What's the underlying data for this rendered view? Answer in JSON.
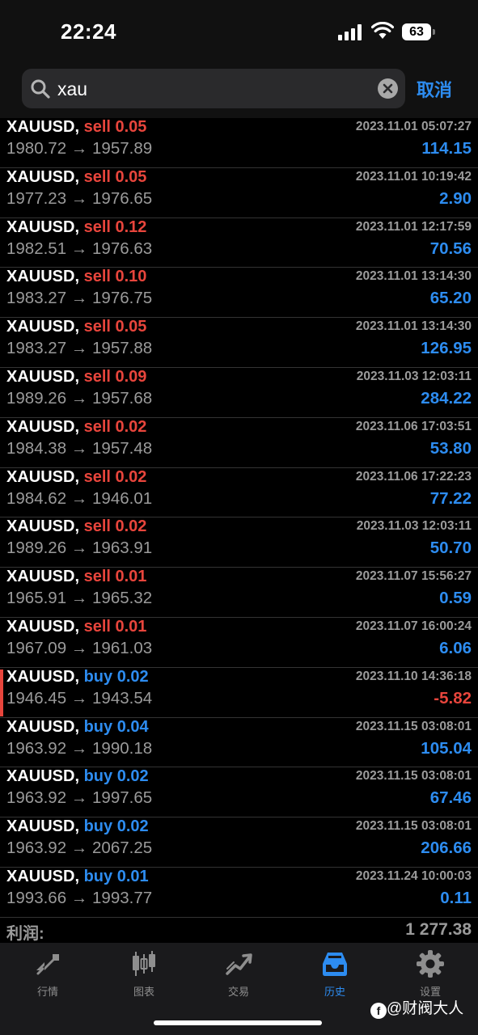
{
  "status_bar": {
    "time": "22:24",
    "battery": "63"
  },
  "search": {
    "value": "xau",
    "cancel_label": "取消"
  },
  "trades": [
    {
      "symbol": "XAUUSD,",
      "side": "sell",
      "volume": "0.05",
      "date": "2023.11.01 05:07:27",
      "open": "1980.72",
      "close": "1957.89",
      "profit": "114.15"
    },
    {
      "symbol": "XAUUSD,",
      "side": "sell",
      "volume": "0.05",
      "date": "2023.11.01 10:19:42",
      "open": "1977.23",
      "close": "1976.65",
      "profit": "2.90"
    },
    {
      "symbol": "XAUUSD,",
      "side": "sell",
      "volume": "0.12",
      "date": "2023.11.01 12:17:59",
      "open": "1982.51",
      "close": "1976.63",
      "profit": "70.56"
    },
    {
      "symbol": "XAUUSD,",
      "side": "sell",
      "volume": "0.10",
      "date": "2023.11.01 13:14:30",
      "open": "1983.27",
      "close": "1976.75",
      "profit": "65.20"
    },
    {
      "symbol": "XAUUSD,",
      "side": "sell",
      "volume": "0.05",
      "date": "2023.11.01 13:14:30",
      "open": "1983.27",
      "close": "1957.88",
      "profit": "126.95"
    },
    {
      "symbol": "XAUUSD,",
      "side": "sell",
      "volume": "0.09",
      "date": "2023.11.03 12:03:11",
      "open": "1989.26",
      "close": "1957.68",
      "profit": "284.22"
    },
    {
      "symbol": "XAUUSD,",
      "side": "sell",
      "volume": "0.02",
      "date": "2023.11.06 17:03:51",
      "open": "1984.38",
      "close": "1957.48",
      "profit": "53.80"
    },
    {
      "symbol": "XAUUSD,",
      "side": "sell",
      "volume": "0.02",
      "date": "2023.11.06 17:22:23",
      "open": "1984.62",
      "close": "1946.01",
      "profit": "77.22"
    },
    {
      "symbol": "XAUUSD,",
      "side": "sell",
      "volume": "0.02",
      "date": "2023.11.03 12:03:11",
      "open": "1989.26",
      "close": "1963.91",
      "profit": "50.70"
    },
    {
      "symbol": "XAUUSD,",
      "side": "sell",
      "volume": "0.01",
      "date": "2023.11.07 15:56:27",
      "open": "1965.91",
      "close": "1965.32",
      "profit": "0.59"
    },
    {
      "symbol": "XAUUSD,",
      "side": "sell",
      "volume": "0.01",
      "date": "2023.11.07 16:00:24",
      "open": "1967.09",
      "close": "1961.03",
      "profit": "6.06"
    },
    {
      "symbol": "XAUUSD,",
      "side": "buy",
      "volume": "0.02",
      "date": "2023.11.10 14:36:18",
      "open": "1946.45",
      "close": "1943.54",
      "profit": "-5.82",
      "marked": true
    },
    {
      "symbol": "XAUUSD,",
      "side": "buy",
      "volume": "0.04",
      "date": "2023.11.15 03:08:01",
      "open": "1963.92",
      "close": "1990.18",
      "profit": "105.04"
    },
    {
      "symbol": "XAUUSD,",
      "side": "buy",
      "volume": "0.02",
      "date": "2023.11.15 03:08:01",
      "open": "1963.92",
      "close": "1997.65",
      "profit": "67.46"
    },
    {
      "symbol": "XAUUSD,",
      "side": "buy",
      "volume": "0.02",
      "date": "2023.11.15 03:08:01",
      "open": "1963.92",
      "close": "2067.25",
      "profit": "206.66"
    },
    {
      "symbol": "XAUUSD,",
      "side": "buy",
      "volume": "0.01",
      "date": "2023.11.24 10:00:03",
      "open": "1993.66",
      "close": "1993.77",
      "profit": "0.11"
    }
  ],
  "summary": {
    "label": "利润:",
    "value": "1 277.38"
  },
  "tabs": [
    {
      "label": "行情",
      "icon": "quotes-icon"
    },
    {
      "label": "图表",
      "icon": "chart-icon"
    },
    {
      "label": "交易",
      "icon": "trade-icon"
    },
    {
      "label": "历史",
      "icon": "history-icon",
      "active": true
    },
    {
      "label": "设置",
      "icon": "settings-icon"
    }
  ],
  "watermark": {
    "text": "@财阀大人"
  },
  "colors": {
    "sell": "#e8453c",
    "buy": "#2d8cf0",
    "positive_profit": "#2d8cf0",
    "negative_profit": "#e8453c",
    "active_tab": "#2d8cf0"
  }
}
